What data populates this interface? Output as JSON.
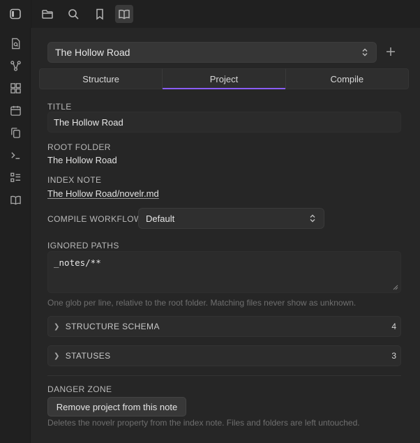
{
  "project_selector": {
    "value": "The Hollow Road"
  },
  "tabs": [
    {
      "label": "Structure"
    },
    {
      "label": "Project"
    },
    {
      "label": "Compile"
    }
  ],
  "active_tab": "Project",
  "fields": {
    "title_label": "TITLE",
    "title_value": "The Hollow Road",
    "root_folder_label": "ROOT FOLDER",
    "root_folder_value": "The Hollow Road",
    "index_note_label": "INDEX NOTE",
    "index_note_value": "The Hollow Road/novelr.md",
    "compile_workflow_label": "COMPILE WORKFLOW",
    "compile_workflow_value": "Default",
    "ignored_paths_label": "IGNORED PATHS",
    "ignored_paths_value": "_notes/**",
    "ignored_paths_hint": "One glob per line, relative to the root folder. Matching files never show as unknown."
  },
  "sections": [
    {
      "label": "STRUCTURE SCHEMA",
      "count": "4"
    },
    {
      "label": "STATUSES",
      "count": "3"
    }
  ],
  "danger": {
    "label": "DANGER ZONE",
    "button": "Remove project from this note",
    "hint": "Deletes the novelr property from the index note. Files and folders are left untouched."
  },
  "colors": {
    "accent": "#8a5cf5",
    "background": "#262626",
    "sidebar": "#202020"
  }
}
